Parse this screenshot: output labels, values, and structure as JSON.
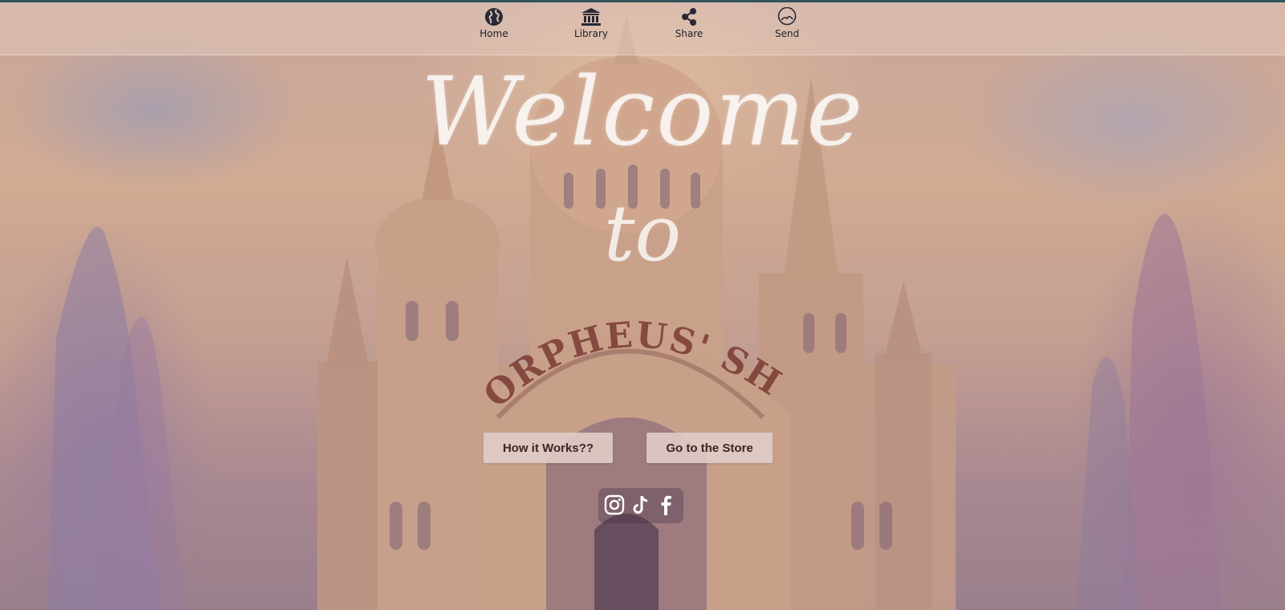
{
  "nav": {
    "items": [
      {
        "label": "Home",
        "icon": "globe-icon"
      },
      {
        "label": "Library",
        "icon": "library-icon"
      },
      {
        "label": "Share",
        "icon": "share-icon"
      },
      {
        "label": "Send",
        "icon": "chat-bubble-icon"
      }
    ]
  },
  "hero": {
    "title_line1": "Welcome",
    "title_line2": "to",
    "sign_text": "MORPHEUS' SHOP"
  },
  "buttons": {
    "how_label": "How it Works??",
    "store_label": "Go to the Store"
  },
  "social": {
    "icons": [
      "instagram-icon",
      "tiktok-icon",
      "facebook-icon"
    ]
  },
  "colors": {
    "top_strip": "#33535d",
    "button_bg": "#e0ccc8",
    "button_text": "#3d2424",
    "sign_text": "#7a3a34"
  }
}
